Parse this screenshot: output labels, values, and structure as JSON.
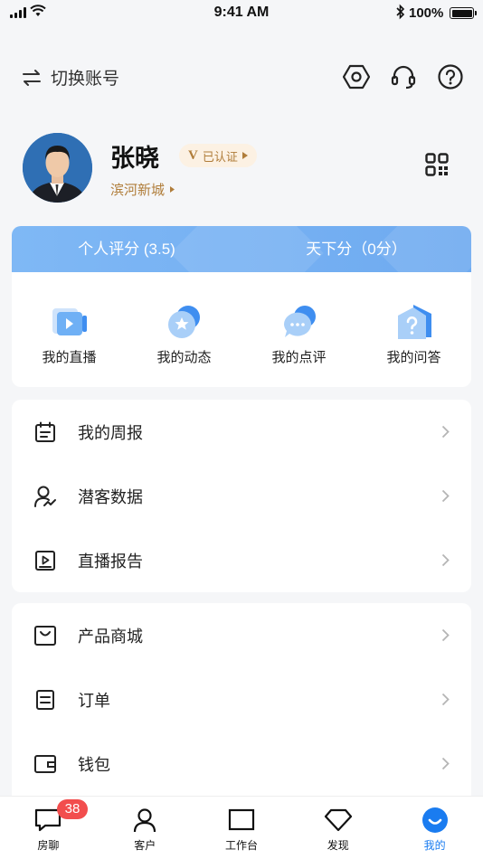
{
  "status_bar": {
    "time": "9:41 AM",
    "battery": "100%"
  },
  "topbar": {
    "switch_label": "切换账号"
  },
  "profile": {
    "name": "张晓",
    "verified_label": "已认证",
    "verified_mark": "V",
    "area": "滨河新城"
  },
  "scores": {
    "personal": "个人评分 (3.5)",
    "world": "天下分（0分）"
  },
  "quick": [
    {
      "label": "我的直播",
      "icon": "live-video-icon"
    },
    {
      "label": "我的动态",
      "icon": "moments-star-icon"
    },
    {
      "label": "我的点评",
      "icon": "comment-bubble-icon"
    },
    {
      "label": "我的问答",
      "icon": "question-house-icon"
    }
  ],
  "menu1": [
    {
      "label": "我的周报",
      "icon": "calendar-icon"
    },
    {
      "label": "潜客数据",
      "icon": "user-chart-icon"
    },
    {
      "label": "直播报告",
      "icon": "play-report-icon"
    }
  ],
  "menu2": [
    {
      "label": "产品商城",
      "icon": "shopping-bag-icon"
    },
    {
      "label": "订单",
      "icon": "order-icon"
    },
    {
      "label": "钱包",
      "icon": "wallet-icon"
    }
  ],
  "tabbar": {
    "badge": "38",
    "tabs": [
      {
        "label": "房聊",
        "icon": "chat-icon"
      },
      {
        "label": "客户",
        "icon": "customer-icon"
      },
      {
        "label": "工作台",
        "icon": "workbench-icon"
      },
      {
        "label": "发现",
        "icon": "discover-diamond-icon"
      },
      {
        "label": "我的",
        "icon": "profile-smile-icon",
        "active": true
      }
    ]
  },
  "colors": {
    "accent": "#1a7cf0",
    "gold": "#b07d3a",
    "badge": "#f24d4d",
    "band": "#7fb8f5"
  }
}
